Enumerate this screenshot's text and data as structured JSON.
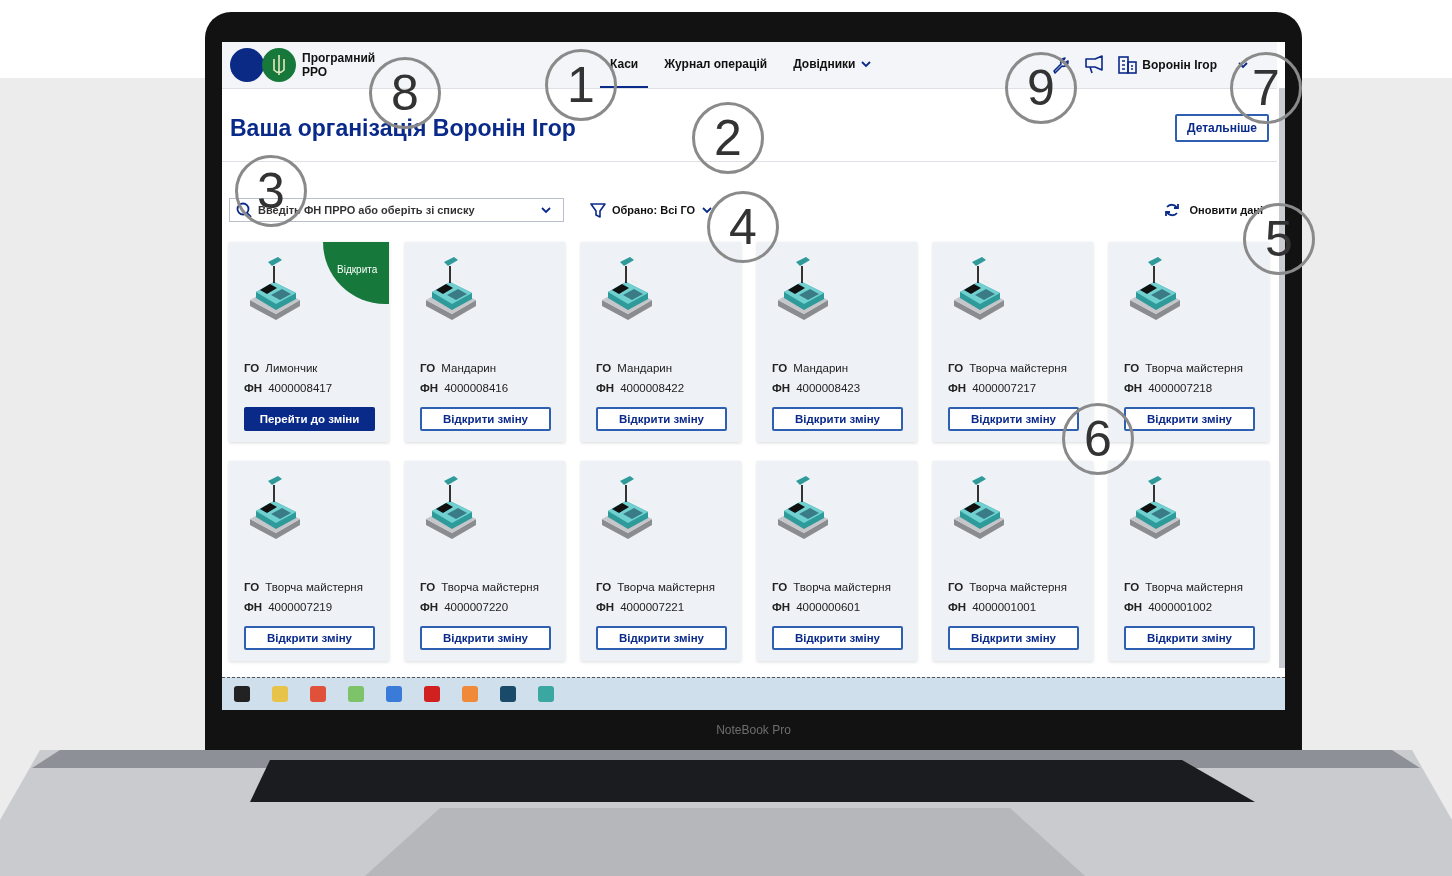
{
  "app": {
    "logo_text": "Програмний РРО",
    "nav": [
      {
        "label": "Каси",
        "selected": true,
        "dropdown": false
      },
      {
        "label": "Журнал операцій",
        "selected": false,
        "dropdown": false
      },
      {
        "label": "Довідники",
        "selected": false,
        "dropdown": true
      }
    ],
    "user": {
      "name": "Воронін Ігор"
    },
    "title": "Ваша організація Воронін Ігор",
    "details_button": "Детальніше",
    "search": {
      "placeholder": "Введіть ФН ПРРО або оберіть зі списку"
    },
    "filter": {
      "label": "Обрано: Всі ГО"
    },
    "refresh": {
      "label": "Оновити дані"
    },
    "cards": [
      {
        "group_label": "ГО",
        "group": "Лимончик",
        "fn_label": "ФН",
        "fn": "4000008417",
        "status": "Відкрита",
        "button": {
          "label": "Перейти до зміни",
          "kind": "primary"
        }
      },
      {
        "group_label": "ГО",
        "group": "Мандарин",
        "fn_label": "ФН",
        "fn": "4000008416",
        "button": {
          "label": "Відкрити зміну",
          "kind": "outline"
        }
      },
      {
        "group_label": "ГО",
        "group": "Мандарин",
        "fn_label": "ФН",
        "fn": "4000008422",
        "button": {
          "label": "Відкрити зміну",
          "kind": "outline"
        }
      },
      {
        "group_label": "ГО",
        "group": "Мандарин",
        "fn_label": "ФН",
        "fn": "4000008423",
        "button": {
          "label": "Відкрити зміну",
          "kind": "outline"
        }
      },
      {
        "group_label": "ГО",
        "group": "Творча майстерня",
        "fn_label": "ФН",
        "fn": "4000007217",
        "button": {
          "label": "Відкрити зміну",
          "kind": "outline"
        }
      },
      {
        "group_label": "ГО",
        "group": "Творча майстерня",
        "fn_label": "ФН",
        "fn": "4000007218",
        "button": {
          "label": "Відкрити зміну",
          "kind": "outline"
        }
      },
      {
        "group_label": "ГО",
        "group": "Творча майстерня",
        "fn_label": "ФН",
        "fn": "4000007219",
        "button": {
          "label": "Відкрити зміну",
          "kind": "outline"
        }
      },
      {
        "group_label": "ГО",
        "group": "Творча майстерня",
        "fn_label": "ФН",
        "fn": "4000007220",
        "button": {
          "label": "Відкрити зміну",
          "kind": "outline"
        }
      },
      {
        "group_label": "ГО",
        "group": "Творча майстерня",
        "fn_label": "ФН",
        "fn": "4000007221",
        "button": {
          "label": "Відкрити зміну",
          "kind": "outline"
        }
      },
      {
        "group_label": "ГО",
        "group": "Творча майстерня",
        "fn_label": "ФН",
        "fn": "4000000601",
        "button": {
          "label": "Відкрити зміну",
          "kind": "outline"
        }
      },
      {
        "group_label": "ГО",
        "group": "Творча майстерня",
        "fn_label": "ФН",
        "fn": "4000001001",
        "button": {
          "label": "Відкрити зміну",
          "kind": "outline"
        }
      },
      {
        "group_label": "ГО",
        "group": "Творча майстерня",
        "fn_label": "ФН",
        "fn": "4000001002",
        "button": {
          "label": "Відкрити зміну",
          "kind": "outline"
        }
      }
    ]
  },
  "taskbar": {
    "apps": [
      {
        "color": "#222222"
      },
      {
        "color": "#e8c34a"
      },
      {
        "color": "#e0503a"
      },
      {
        "color": "#7cc36a"
      },
      {
        "color": "#3a7ad8"
      },
      {
        "color": "#d02020"
      },
      {
        "color": "#f08a3a"
      },
      {
        "color": "#1a4a6a"
      },
      {
        "color": "#3aa8a0"
      }
    ]
  },
  "laptop": {
    "label": "NoteBook Pro"
  },
  "callouts": [
    {
      "number": "8"
    },
    {
      "number": "1"
    },
    {
      "number": "9"
    },
    {
      "number": "7"
    },
    {
      "number": "2"
    },
    {
      "number": "3"
    },
    {
      "number": "4"
    },
    {
      "number": "5"
    },
    {
      "number": "6"
    }
  ]
}
